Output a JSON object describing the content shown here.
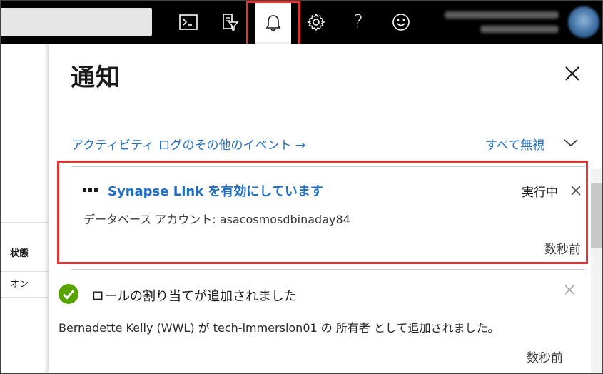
{
  "topbar": {
    "icons": [
      "cloud-shell-icon",
      "directory-filter-icon",
      "bell-icon",
      "gear-icon",
      "help-icon",
      "feedback-smiley-icon"
    ],
    "help_glyph": "?",
    "active_icon": "bell-icon",
    "highlight_color": "#e03535"
  },
  "sidebar": {
    "column_header": "状態",
    "row_value": "オン"
  },
  "notifications": {
    "title": "通知",
    "activity_log_link": "アクティビティ ログのその他のイベント",
    "activity_log_arrow": "→",
    "dismiss_all": "すべて無視",
    "items": [
      {
        "title": "Synapse Link を有効にしています",
        "status": "実行中",
        "description": "データベース アカウント: asacosmosdbinaday84",
        "time": "数秒前"
      },
      {
        "title": "ロールの割り当てが追加されました",
        "description": "Bernadette Kelly (WWL) が tech-immersion01 の 所有者 として追加されました。",
        "time": "数秒前"
      }
    ]
  },
  "colors": {
    "link": "#1f6fc5",
    "success": "#57a300",
    "topbar_bg": "#000000"
  }
}
